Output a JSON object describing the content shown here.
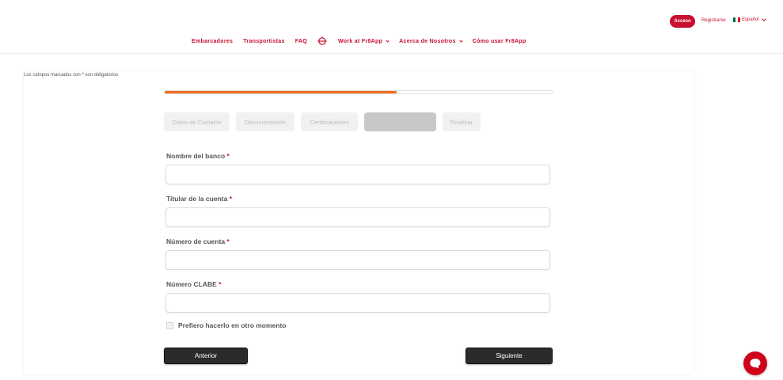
{
  "header": {
    "access_label": "Acceso",
    "register_label": "Registrarse",
    "language_label": "Español",
    "nav": [
      {
        "label": "Embarcadores"
      },
      {
        "label": "Transportistas"
      },
      {
        "label": "FAQ"
      },
      {
        "label": "Work at Fr8App"
      },
      {
        "label": "Acerca de Nosotros"
      },
      {
        "label": "Cómo usar Fr8App"
      }
    ]
  },
  "form": {
    "required_note_prefix": "Los campos marcados con ",
    "required_note_star": "*",
    "required_note_suffix": " son obligatorios",
    "progress": 0.6,
    "steps": [
      {
        "label": "Datos de Contacto"
      },
      {
        "label": "Documentación"
      },
      {
        "label": "Certificaciones"
      },
      {
        "label": ""
      },
      {
        "label": "Finalizar"
      }
    ],
    "fields": [
      {
        "label": "Nombre del banco",
        "star": "*",
        "value": ""
      },
      {
        "label": "Titular de la cuenta",
        "star": "*",
        "value": ""
      },
      {
        "label": "Número de cuenta",
        "star": "*",
        "value": ""
      },
      {
        "label": "Número CLABE",
        "star": "*",
        "value": ""
      }
    ],
    "later_checkbox_label": "Prefiero hacerlo en otro momento",
    "prev_label": "Anterior",
    "next_label": "Siguiente"
  },
  "colors": {
    "brand": "#c8102e",
    "progress": "#f26b1d"
  }
}
